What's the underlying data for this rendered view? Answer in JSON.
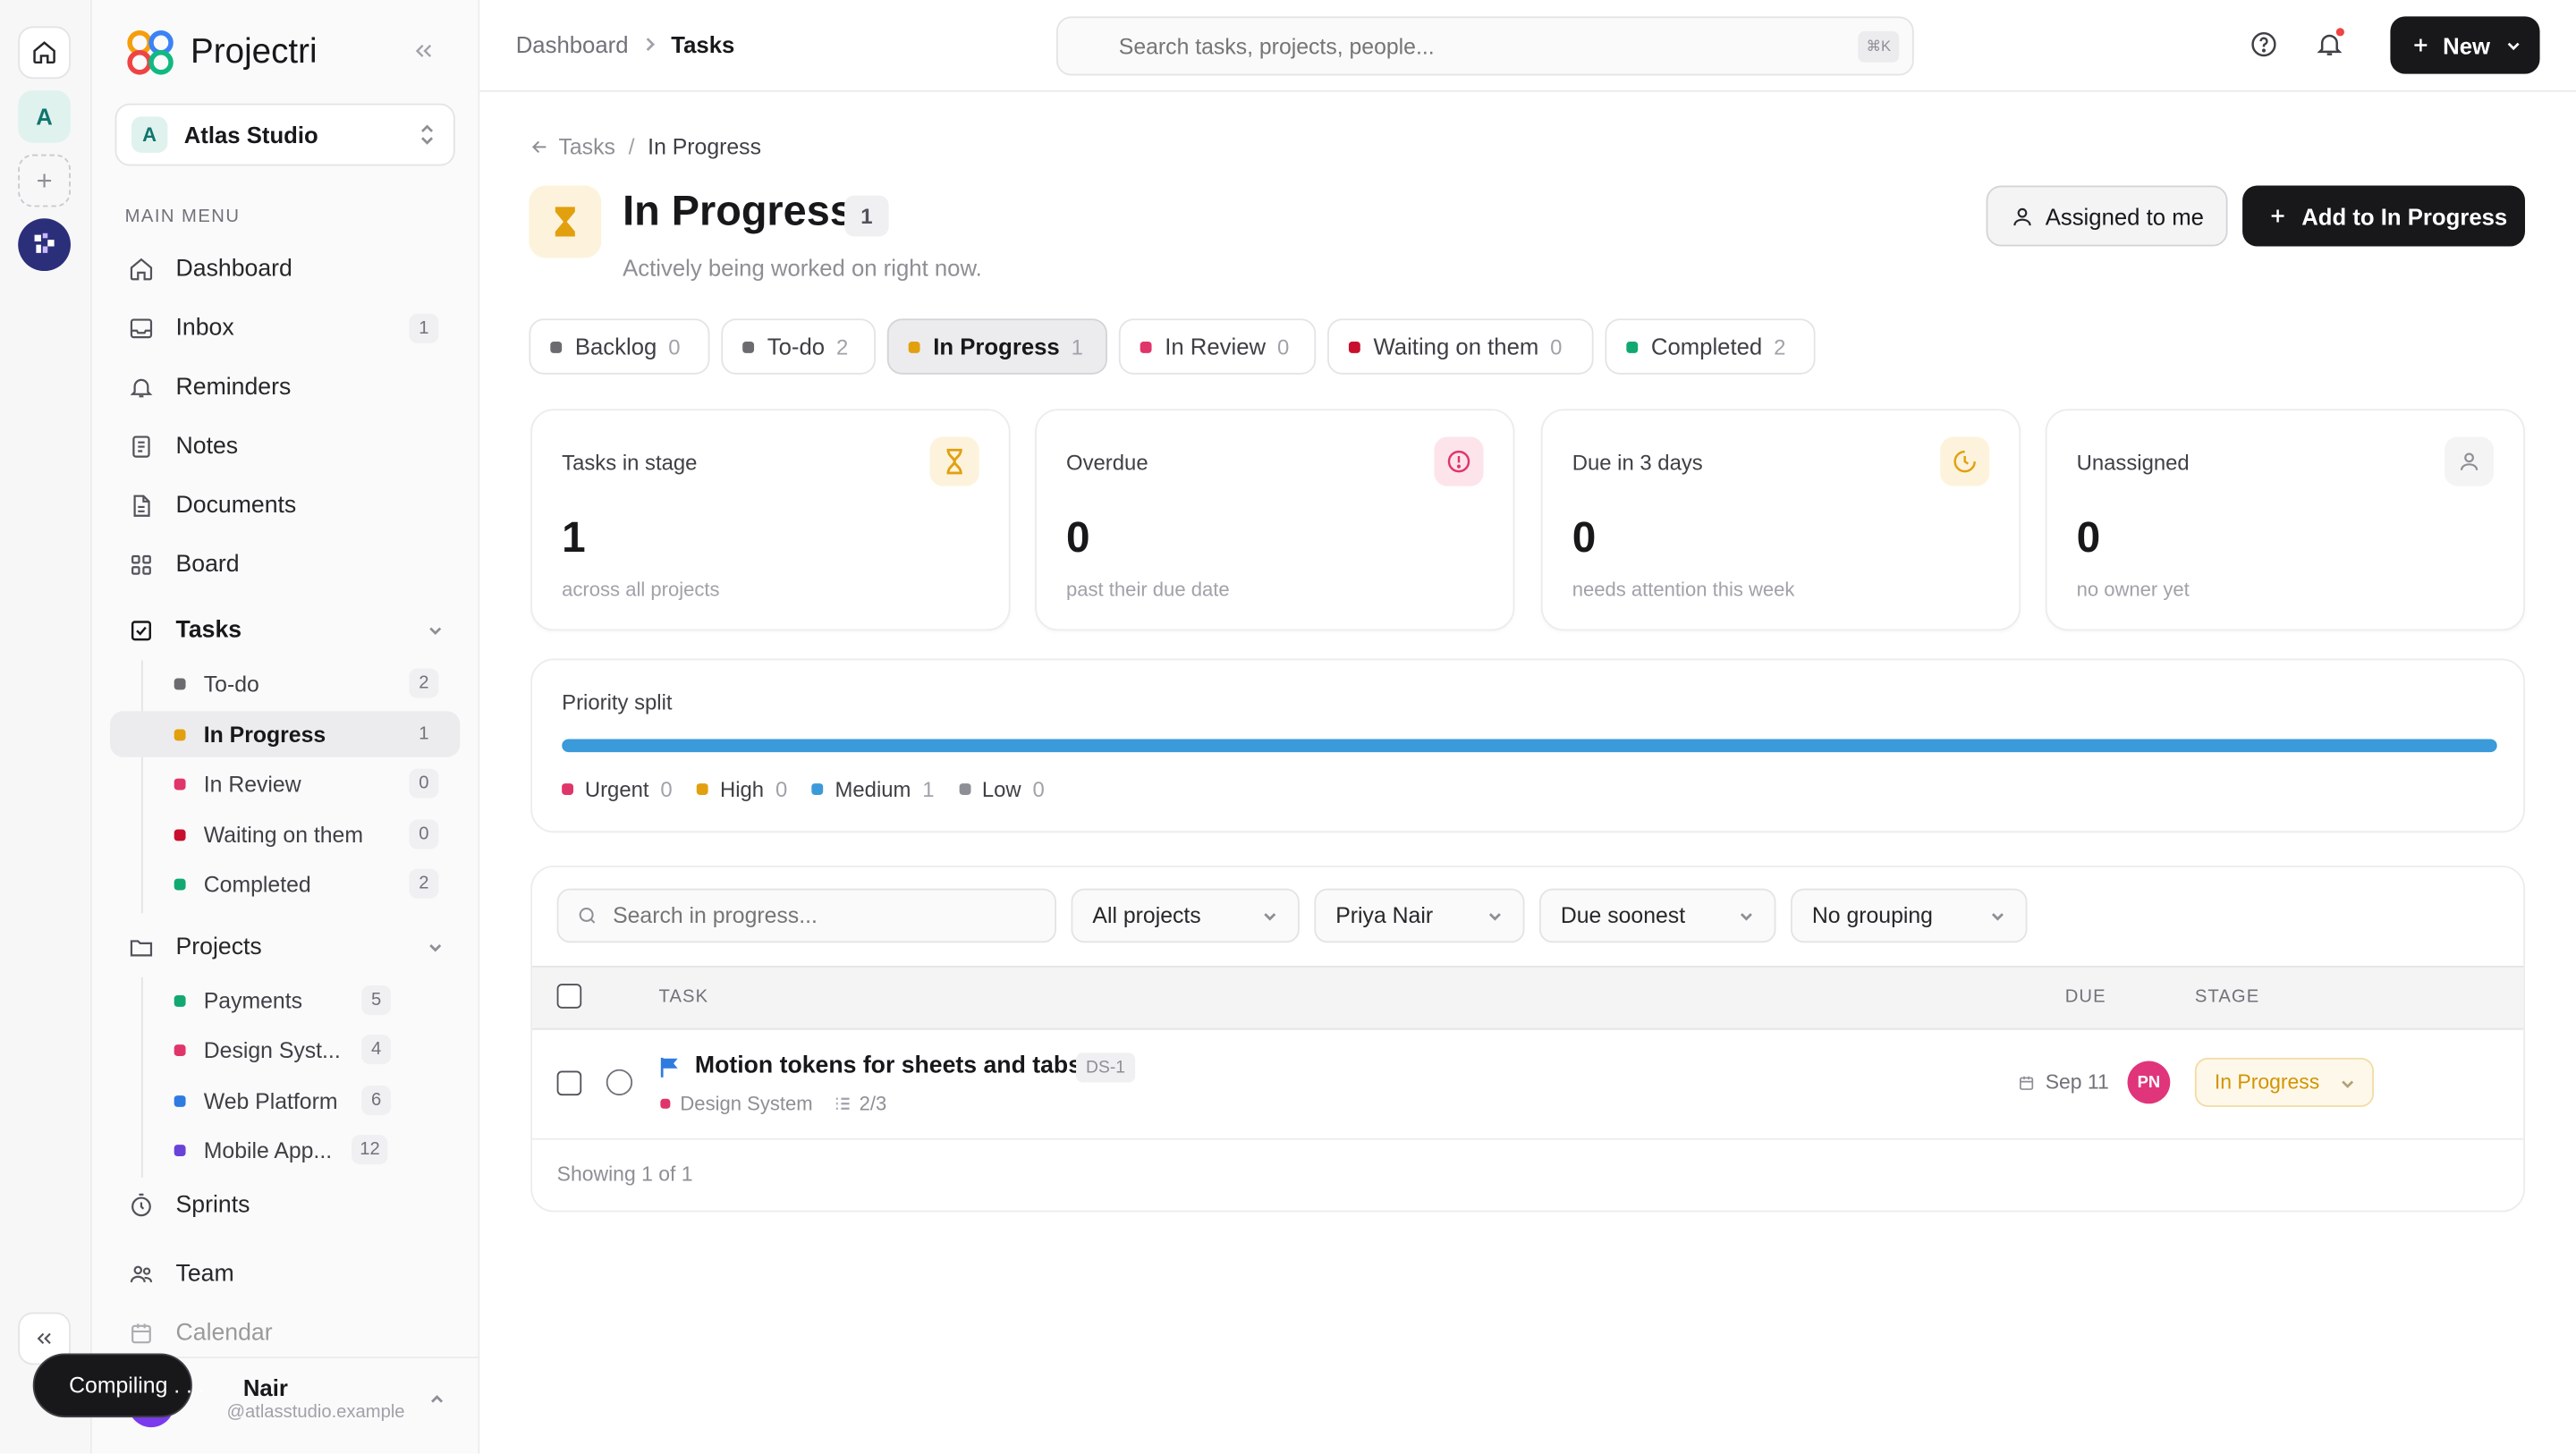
{
  "app": {
    "name": "Projectri"
  },
  "rail": {
    "avatar_letter": "A"
  },
  "workspace": {
    "letter": "A",
    "name": "Atlas Studio"
  },
  "sidebar": {
    "section_label": "MAIN MENU",
    "items": [
      {
        "label": "Dashboard"
      },
      {
        "label": "Inbox",
        "count": "1"
      },
      {
        "label": "Reminders"
      },
      {
        "label": "Notes"
      },
      {
        "label": "Documents"
      },
      {
        "label": "Board"
      }
    ],
    "tasks": {
      "label": "Tasks",
      "children": [
        {
          "label": "To-do",
          "count": "2",
          "color": "#6b6b70"
        },
        {
          "label": "In Progress",
          "count": "1",
          "color": "#e2a00f"
        },
        {
          "label": "In Review",
          "count": "0",
          "color": "#e0356b"
        },
        {
          "label": "Waiting on them",
          "count": "0",
          "color": "#c8102e"
        },
        {
          "label": "Completed",
          "count": "2",
          "color": "#12a871"
        }
      ]
    },
    "projects": {
      "label": "Projects",
      "children": [
        {
          "label": "Payments",
          "count": "5",
          "color": "#12a871"
        },
        {
          "label": "Design Syst...",
          "count": "4",
          "color": "#e0356b"
        },
        {
          "label": "Web Platform",
          "count": "6",
          "color": "#2f7be0"
        },
        {
          "label": "Mobile App...",
          "count": "12",
          "color": "#6a42d8"
        }
      ]
    },
    "sprints": "Sprints",
    "team": "Team",
    "calendar": "Calendar",
    "user": {
      "name": "Nair",
      "email": "@atlasstudio.example"
    },
    "compiling": "Compiling . . ."
  },
  "topbar": {
    "breadcrumb": [
      "Dashboard",
      "Tasks"
    ],
    "search_placeholder": "Search tasks, projects, people...",
    "search_kbd": "⌘K",
    "new_label": "New"
  },
  "page": {
    "back_link": "Tasks",
    "crumb_sep": "/",
    "crumb_current": "In Progress",
    "title": "In Progress",
    "count": "1",
    "subtitle": "Actively being worked on right now.",
    "assigned_btn": "Assigned to me",
    "add_btn": "Add to In Progress"
  },
  "stages": [
    {
      "label": "Backlog",
      "count": "0",
      "color": "#6b6b70"
    },
    {
      "label": "To-do",
      "count": "2",
      "color": "#6b6b70"
    },
    {
      "label": "In Progress",
      "count": "1",
      "color": "#e2a00f",
      "active": true
    },
    {
      "label": "In Review",
      "count": "0",
      "color": "#e0356b"
    },
    {
      "label": "Waiting on them",
      "count": "0",
      "color": "#c8102e"
    },
    {
      "label": "Completed",
      "count": "2",
      "color": "#12a871"
    }
  ],
  "stats": [
    {
      "label": "Tasks in stage",
      "value": "1",
      "sub": "across all projects",
      "icon": "hourglass-icon",
      "accent": "#e2a00f",
      "bg": "#fdf3dc"
    },
    {
      "label": "Overdue",
      "value": "0",
      "sub": "past their due date",
      "icon": "alert-circle-icon",
      "accent": "#e0356b",
      "bg": "#fde4ea"
    },
    {
      "label": "Due in 3 days",
      "value": "0",
      "sub": "needs attention this week",
      "icon": "clock-icon",
      "accent": "#e2a00f",
      "bg": "#fdf3dc"
    },
    {
      "label": "Unassigned",
      "value": "0",
      "sub": "no owner yet",
      "icon": "user-icon",
      "accent": "#8e8e95",
      "bg": "#f4f4f5"
    }
  ],
  "priority": {
    "title": "Priority split",
    "bar_color": "#3b9ad9",
    "medium_fraction": 1.0,
    "items": [
      {
        "label": "Urgent",
        "count": "0",
        "color": "#e0356b"
      },
      {
        "label": "High",
        "count": "0",
        "color": "#e2a00f"
      },
      {
        "label": "Medium",
        "count": "1",
        "color": "#3b9ad9"
      },
      {
        "label": "Low",
        "count": "0",
        "color": "#8e8e95"
      }
    ]
  },
  "filters": {
    "search_placeholder": "Search in progress...",
    "project": "All projects",
    "assignee": "Priya Nair",
    "sort": "Due soonest",
    "group": "No grouping"
  },
  "table": {
    "headers": {
      "task": "TASK",
      "due": "DUE",
      "stage": "STAGE"
    },
    "rows": [
      {
        "title": "Motion tokens for sheets and tabs",
        "id": "DS-1",
        "project": "Design System",
        "subtasks": "2/3",
        "due": "Sep 11",
        "assignee_initials": "PN",
        "stage": "In Progress"
      }
    ],
    "footer": "Showing 1 of 1"
  }
}
